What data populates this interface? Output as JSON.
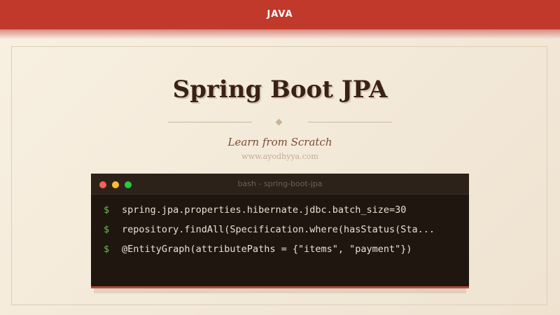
{
  "header": {
    "label": "JAVA"
  },
  "hero": {
    "title": "Spring Boot JPA",
    "subtitle": "Learn from Scratch",
    "website": "www.ayodhyya.com"
  },
  "terminal": {
    "title": "bash - spring-boot-jpa",
    "prompt": "$",
    "commands": [
      "spring.jpa.properties.hibernate.jdbc.batch_size=30",
      "repository.findAll(Specification.where(hasStatus(Sta...",
      "@EntityGraph(attributePaths = {\"items\", \"payment\"})"
    ]
  },
  "colors": {
    "accent": "#c0392b",
    "background": "#f8f0e1",
    "terminal_bg": "#1f1610",
    "prompt": "#6fbf57"
  }
}
